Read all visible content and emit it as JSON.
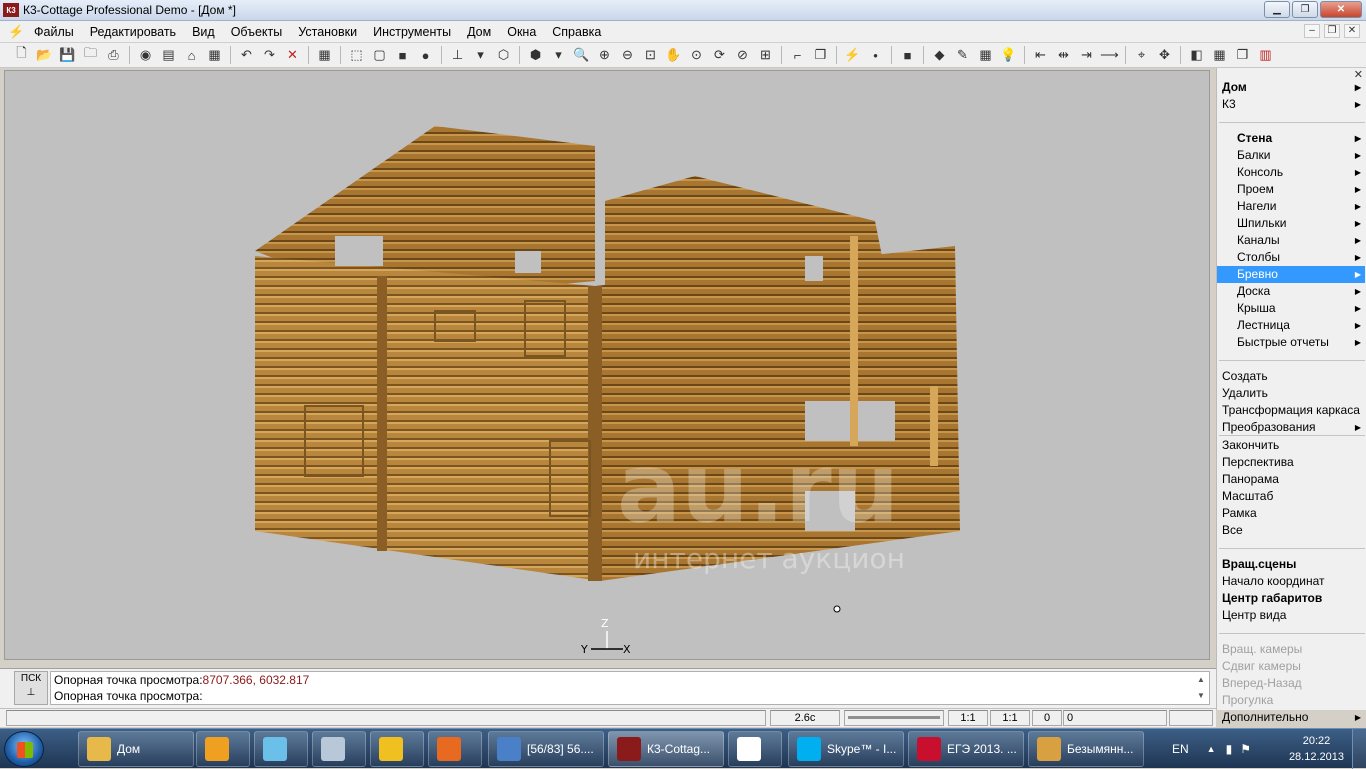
{
  "window": {
    "title": "К3-Cottage Professional Demo - [Дом *]",
    "app_icon": "k3-logo-icon"
  },
  "menu": [
    "Файлы",
    "Редактировать",
    "Вид",
    "Объекты",
    "Установки",
    "Инструменты",
    "Дом",
    "Окна",
    "Справка"
  ],
  "viewport": {
    "background": "#c0c0c0",
    "model_color": "#b8863c",
    "axes": {
      "z": "Z",
      "y": "Y",
      "x": "X"
    },
    "watermark": {
      "main": "au.ru",
      "sub": "интернет аукцион"
    }
  },
  "right_panel": {
    "items": [
      {
        "label": "Дом",
        "bold": true,
        "arrow": true
      },
      {
        "label": "К3",
        "arrow": true
      },
      {
        "label": "Стена",
        "bold": true,
        "arrow": true,
        "indent": true
      },
      {
        "label": "Балки",
        "arrow": true,
        "indent": true
      },
      {
        "label": "Консоль",
        "arrow": true,
        "indent": true
      },
      {
        "label": "Проем",
        "arrow": true,
        "indent": true
      },
      {
        "label": "Нагели",
        "arrow": true,
        "indent": true
      },
      {
        "label": "Шпильки",
        "arrow": true,
        "indent": true
      },
      {
        "label": "Каналы",
        "arrow": true,
        "indent": true
      },
      {
        "label": "Столбы",
        "arrow": true,
        "indent": true
      },
      {
        "label": "Бревно",
        "arrow": true,
        "indent": true,
        "selected": true
      },
      {
        "label": "Доска",
        "arrow": true,
        "indent": true
      },
      {
        "label": "Крыша",
        "arrow": true,
        "indent": true
      },
      {
        "label": "Лестница",
        "arrow": true,
        "indent": true
      },
      {
        "label": "Быстрые отчеты",
        "arrow": true,
        "indent": true
      },
      {
        "label": "Создать"
      },
      {
        "label": "Удалить"
      },
      {
        "label": "Трансформация каркаса"
      },
      {
        "label": "Преобразования",
        "arrow": true
      },
      {
        "label": "Закончить"
      },
      {
        "label": "Перспектива"
      },
      {
        "label": "Панорама"
      },
      {
        "label": "Масштаб"
      },
      {
        "label": "Рамка"
      },
      {
        "label": "Все"
      },
      {
        "label": "Вращ.сцены",
        "bold": true
      },
      {
        "label": "Начало координат"
      },
      {
        "label": "Центр габаритов",
        "bold": true
      },
      {
        "label": "Центр вида"
      },
      {
        "label": "Вращ. камеры",
        "disabled": true
      },
      {
        "label": "Сдвиг камеры",
        "disabled": true
      },
      {
        "label": "Вперед-Назад",
        "disabled": true
      },
      {
        "label": "Прогулка",
        "disabled": true
      },
      {
        "label": "Дополнительно",
        "arrow": true
      }
    ]
  },
  "command": {
    "pcs_label": "ПСК",
    "line1_label": "Опорная точка просмотра:",
    "line1_value": "8707.366, 6032.817",
    "line2_label": "Опорная точка просмотра:"
  },
  "status": {
    "time": "2.6с",
    "scale1": "1:1",
    "scale2": "1:1",
    "v1": "0",
    "v2": "0"
  },
  "taskbar": {
    "buttons": [
      {
        "label": "Дом",
        "icon": "folder-icon",
        "color": "#e6b94a"
      },
      {
        "label": "",
        "icon": "browser-icon",
        "color": "#f0a020"
      },
      {
        "label": "",
        "icon": "notes-icon",
        "color": "#6ac0e8"
      },
      {
        "label": "",
        "icon": "calculator-icon",
        "color": "#b8c8d8"
      },
      {
        "label": "",
        "icon": "archicad-icon",
        "color": "#f0c020"
      },
      {
        "label": "",
        "icon": "ball-icon",
        "color": "#e86a20"
      },
      {
        "label": "[56/83] 56....",
        "icon": "media-icon",
        "color": "#4a80c8"
      },
      {
        "label": "К3-Cottag...",
        "icon": "k3-icon",
        "color": "#8b1a1a",
        "active": true
      },
      {
        "label": "",
        "icon": "player-icon",
        "color": "#ffffff"
      },
      {
        "label": "Skype™ - I...",
        "icon": "skype-icon",
        "color": "#00aff0"
      },
      {
        "label": "ЕГЭ 2013. ...",
        "icon": "pdf-icon",
        "color": "#c8102e"
      },
      {
        "label": "Безымянн...",
        "icon": "paint-icon",
        "color": "#d8a040"
      }
    ],
    "lang": "EN",
    "clock_time": "20:22",
    "clock_date": "28.12.2013"
  }
}
